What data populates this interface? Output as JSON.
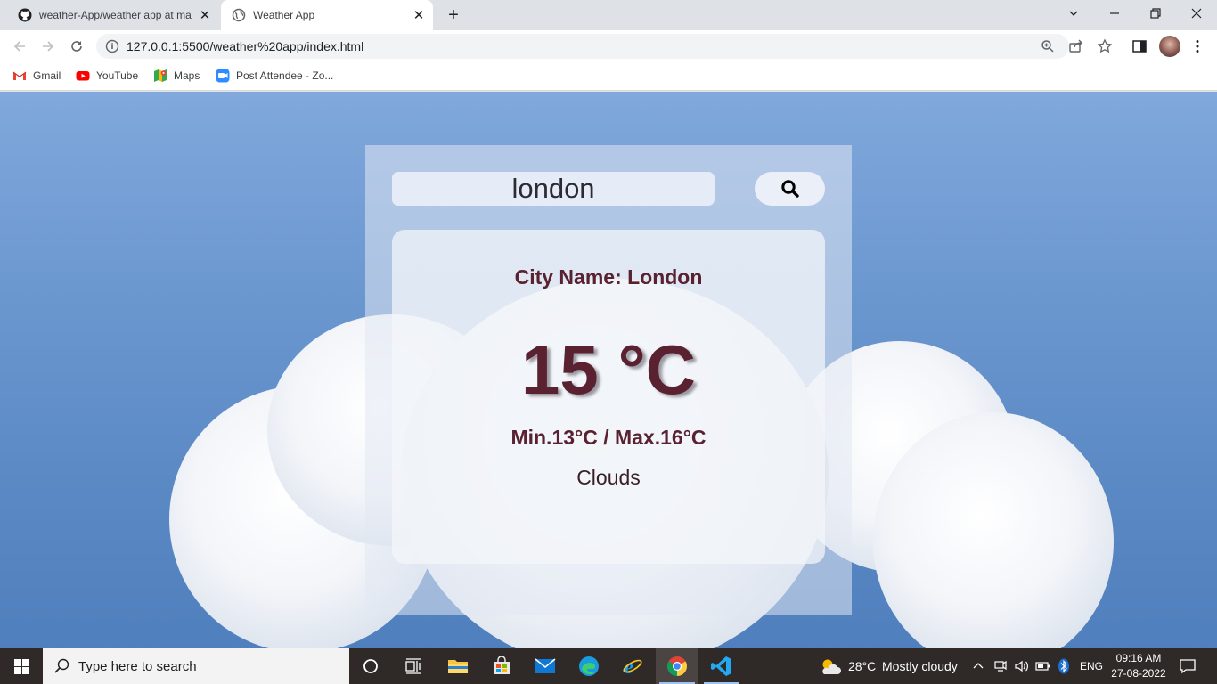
{
  "browser": {
    "tabs": [
      {
        "title": "weather-App/weather app at ma",
        "icon": "github-icon",
        "active": false
      },
      {
        "title": "Weather App",
        "icon": "globe-icon",
        "active": true
      }
    ],
    "new_tab": "+",
    "url": "127.0.0.1:5500/weather%20app/index.html",
    "bookmarks": [
      {
        "label": "Gmail",
        "icon": "gmail-icon"
      },
      {
        "label": "YouTube",
        "icon": "youtube-icon"
      },
      {
        "label": "Maps",
        "icon": "maps-icon"
      },
      {
        "label": "Post Attendee - Zo...",
        "icon": "zoom-icon"
      }
    ]
  },
  "weather": {
    "search_value": "london",
    "city_line": "City Name: London",
    "temperature": "15 °C",
    "min_max": "Min.13°C / Max.16°C",
    "condition": "Clouds",
    "text_color": "#5a2231"
  },
  "taskbar": {
    "search_placeholder": "Type here to search",
    "weather_temp": "28°C",
    "weather_text": "Mostly cloudy",
    "language": "ENG",
    "time": "09:16 AM",
    "date": "27-08-2022"
  }
}
